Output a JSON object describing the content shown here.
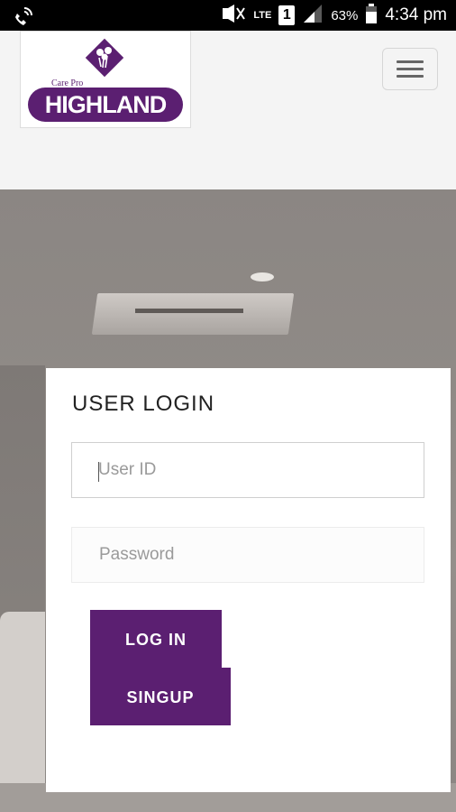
{
  "status_bar": {
    "time": "4:34 pm",
    "battery": "63%",
    "network": "LTE",
    "sim": "1",
    "icons": [
      "phone-wifi-icon",
      "mute-icon",
      "signal-icon",
      "battery-icon"
    ]
  },
  "header": {
    "logo": {
      "brand": "HIGHLAND",
      "tagline": "Care Pro"
    },
    "menu_icon": "hamburger-menu-icon"
  },
  "login": {
    "title": "USER LOGIN",
    "user_id": {
      "placeholder": "User ID",
      "value": ""
    },
    "password": {
      "placeholder": "Password",
      "value": ""
    },
    "login_label": "LOG IN",
    "signup_label": "SINGUP"
  },
  "colors": {
    "brand": "#5b1f71",
    "header_bg": "#f4f4f4",
    "status_bg": "#000000"
  }
}
